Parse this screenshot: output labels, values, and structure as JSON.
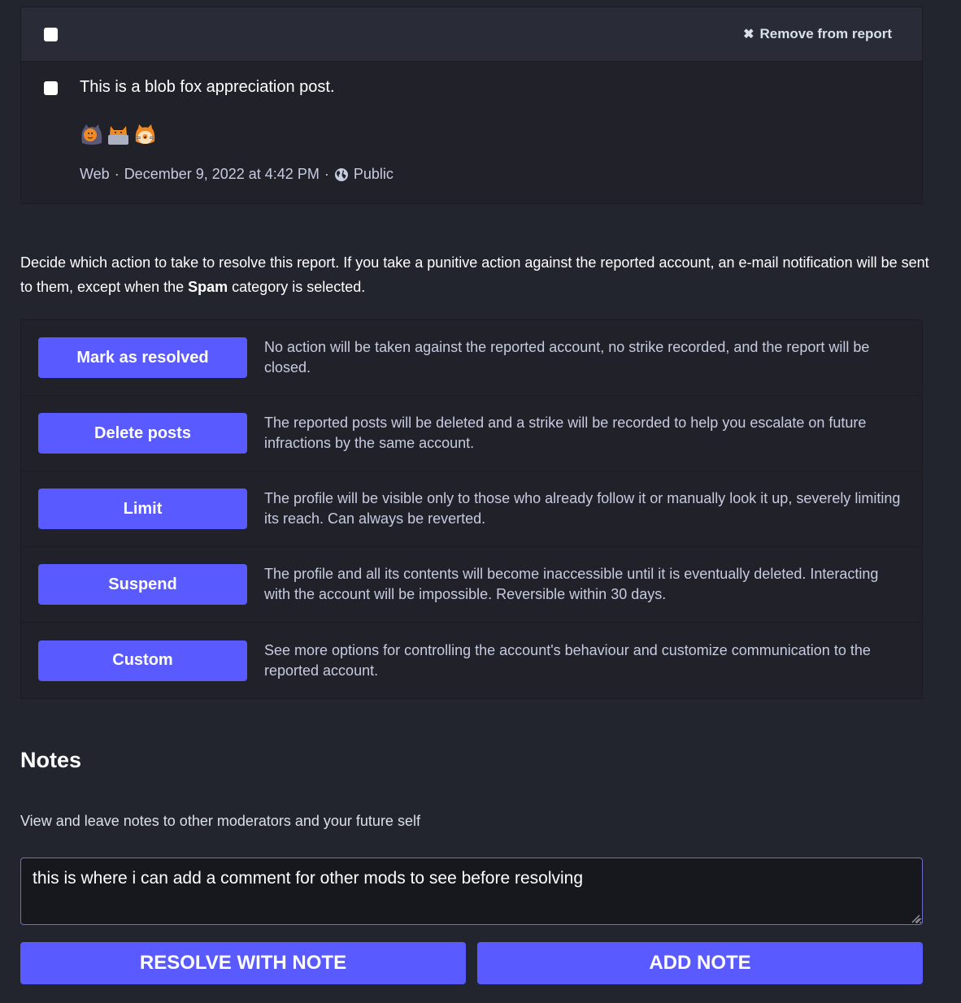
{
  "colors": {
    "accent": "#595aff",
    "background": "#22242e",
    "card": "#202129",
    "card_header": "#292b37",
    "textarea_bg": "#17181e",
    "textarea_border": "#6d6ec9"
  },
  "reported_post": {
    "header": {
      "select_all_checked": false,
      "remove_icon": "close-icon",
      "remove_label": "Remove from report"
    },
    "post": {
      "checked": false,
      "text": "This is a blob fox appreciation post.",
      "emojis": [
        "blobfox-hood",
        "blobfox-laptop",
        "blobfox-cat"
      ],
      "meta": {
        "application": "Web",
        "separator": "·",
        "date": "December 9, 2022 at 4:42 PM",
        "visibility_icon": "globe-icon",
        "visibility": "Public"
      }
    }
  },
  "intro": {
    "text_before": "Decide which action to take to resolve this report. If you take a punitive action against the reported account, an e-mail notification will be sent to them, except when the ",
    "bold": "Spam",
    "text_after": " category is selected."
  },
  "actions": [
    {
      "label": "Mark as resolved",
      "description": "No action will be taken against the reported account, no strike recorded, and the report will be closed."
    },
    {
      "label": "Delete posts",
      "description": "The reported posts will be deleted and a strike will be recorded to help you escalate on future infractions by the same account."
    },
    {
      "label": "Limit",
      "description": "The profile will be visible only to those who already follow it or manually look it up, severely limiting its reach. Can always be reverted."
    },
    {
      "label": "Suspend",
      "description": "The profile and all its contents will become inaccessible until it is eventually deleted. Interacting with the account will be impossible. Reversible within 30 days."
    },
    {
      "label": "Custom",
      "description": "See more options for controlling the account's behaviour and customize communication to the reported account."
    }
  ],
  "notes": {
    "title": "Notes",
    "hint": "View and leave notes to other moderators and your future self",
    "input_value": "this is where i can add a comment for other mods to see before resolving",
    "resolve_with_note_label": "RESOLVE WITH NOTE",
    "add_note_label": "ADD NOTE"
  }
}
